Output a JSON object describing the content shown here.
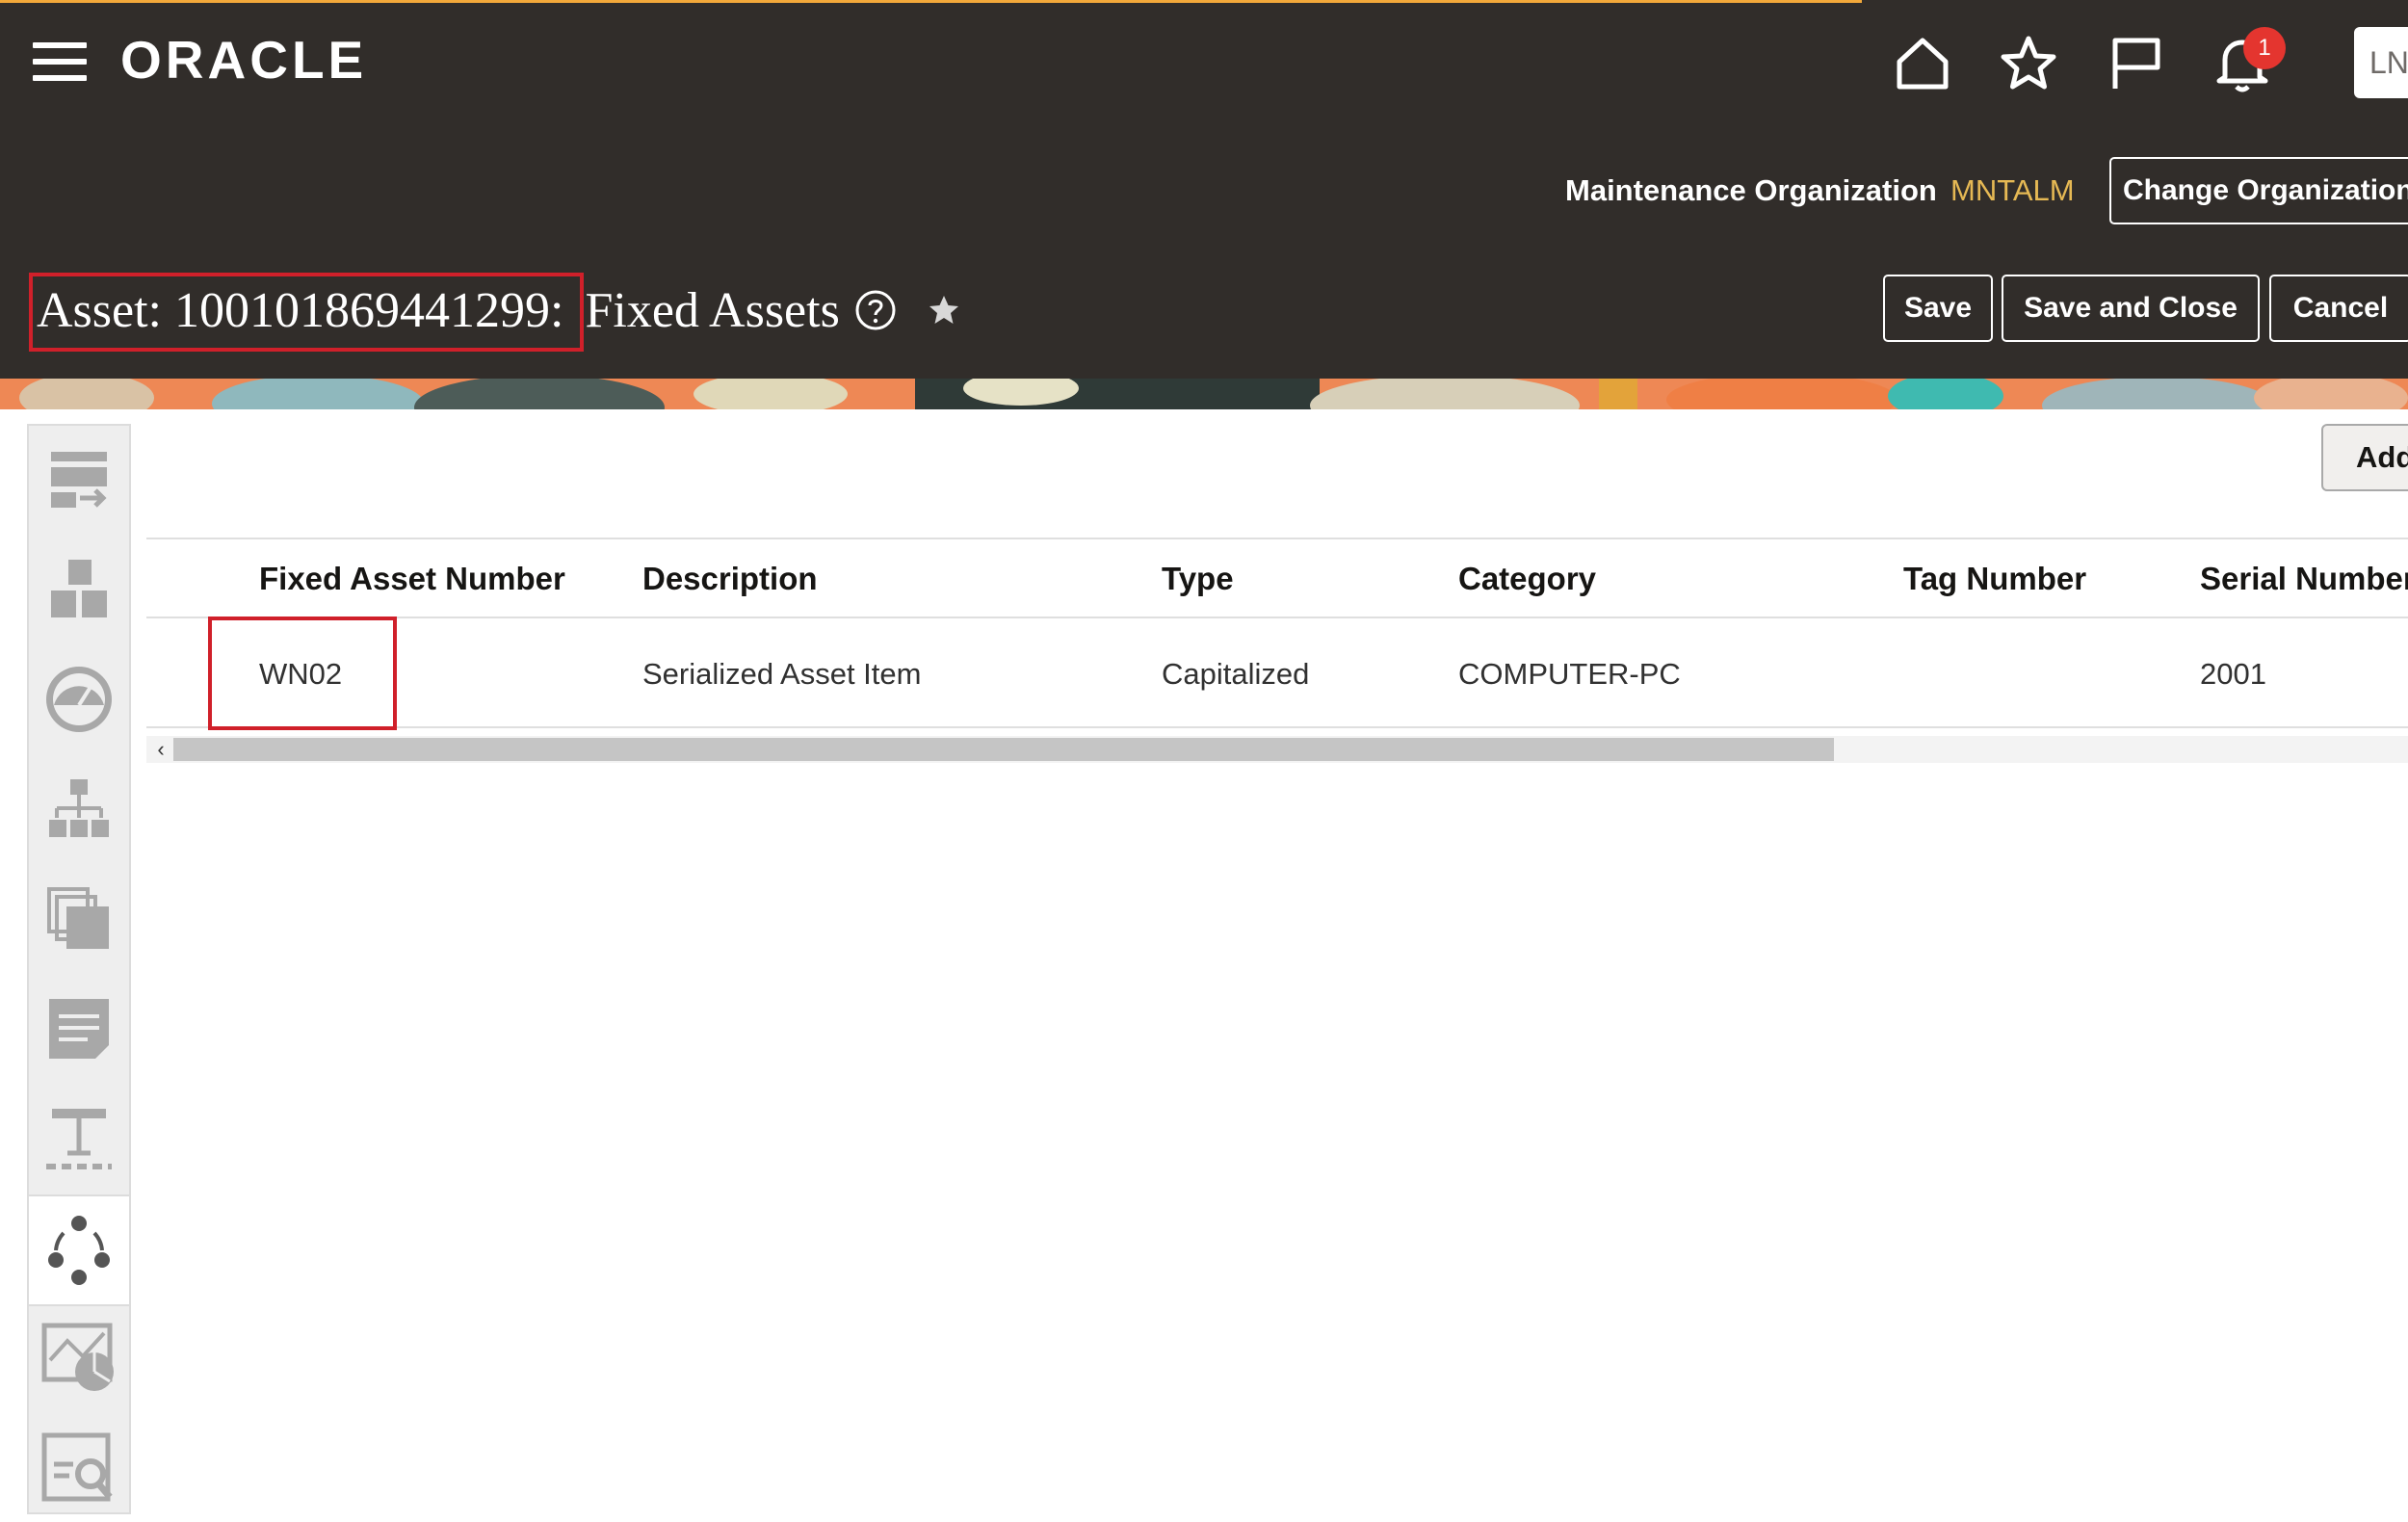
{
  "header": {
    "logo": "ORACLE",
    "notification_count": "1",
    "user_initials": "LN",
    "org_label": "Maintenance Organization",
    "org_value": "MNTALM",
    "change_org_label": "Change Organization",
    "colors": {
      "bg": "#312d2a",
      "accent": "#e6b954",
      "badge": "#e4352f"
    }
  },
  "title": {
    "asset_label": "Asset: 100101869441299",
    "separator": ":",
    "section": "Fixed Assets"
  },
  "actions": {
    "save": "Save",
    "save_close": "Save and Close",
    "cancel": "Cancel",
    "add": "Add"
  },
  "table": {
    "headers": [
      "Fixed Asset Number",
      "Description",
      "Type",
      "Category",
      "Tag Number",
      "Serial Number"
    ],
    "rows": [
      [
        "WN02",
        "Serialized Asset Item",
        "Capitalized",
        "COMPUTER-PC",
        "",
        "2001"
      ]
    ]
  },
  "icons": {
    "menu": "hamburger-icon",
    "home": "home-icon",
    "favorites": "star-icon",
    "flag": "flag-icon",
    "notifications": "bell-icon",
    "help": "help-icon",
    "favorite_page": "star-filled-icon"
  },
  "sidebar": {
    "items": [
      "import-icon",
      "blocks-icon",
      "gauge-icon",
      "hierarchy-icon",
      "documents-icon",
      "notes-icon",
      "structure-icon",
      "cycle-icon",
      "map-report-icon",
      "search-report-icon"
    ],
    "active_index": 7
  }
}
